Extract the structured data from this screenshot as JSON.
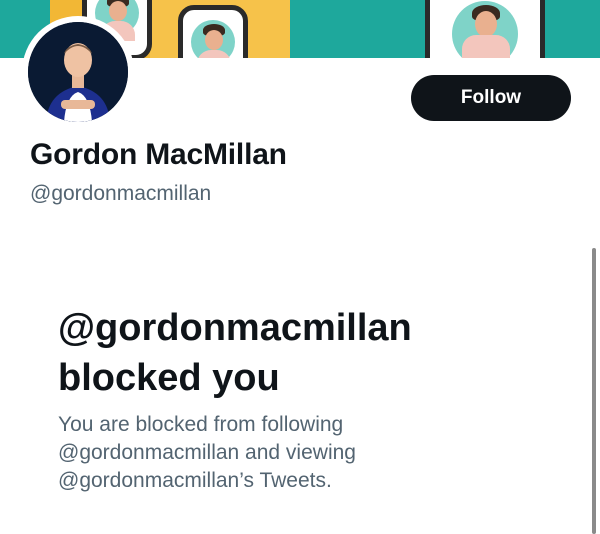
{
  "profile": {
    "display_name": "Gordon MacMillan",
    "handle": "@gordonmacmillan"
  },
  "actions": {
    "follow_label": "Follow"
  },
  "blocked": {
    "title_line1": "@gordonmacmillan",
    "title_line2": "blocked you",
    "desc_line1": "You are blocked from following",
    "desc_line2": "@gordonmacmillan and viewing",
    "desc_line3": "@gordonmacmillan’s Tweets."
  },
  "colors": {
    "banner_teal": "#1ea89c",
    "banner_yellow": "#f2b735",
    "button_bg": "#0f1419",
    "secondary_text": "#536471"
  }
}
